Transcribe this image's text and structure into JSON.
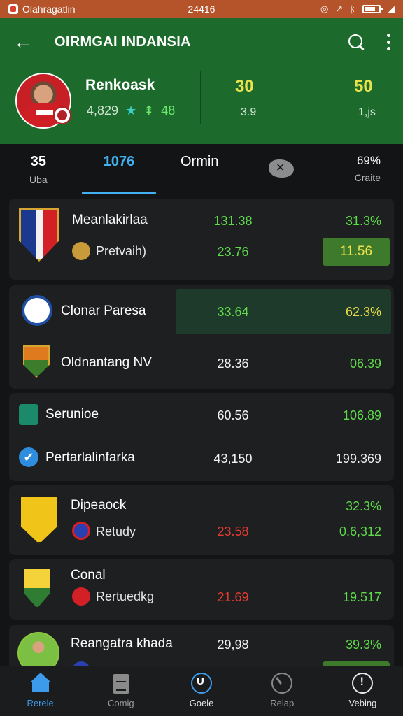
{
  "status_bar": {
    "carrier": "Olahragatlin",
    "time": "24416",
    "battery_level": 0.7
  },
  "header": {
    "title": "OIRMGAI INDANSIA",
    "profile": {
      "name": "Renkoask",
      "followers": "4,829",
      "gain": "48",
      "stat_a_value": "30",
      "stat_a_sub": "3.9",
      "stat_b_value": "50",
      "stat_b_sub": "1,js"
    }
  },
  "tabs": [
    {
      "label": "35",
      "sub": "Uba"
    },
    {
      "label": "1076",
      "sub": ""
    },
    {
      "label": "Ormin",
      "sub": ""
    },
    {
      "label": "",
      "icon": "map-icon"
    },
    {
      "label": "69%",
      "sub": "Craite"
    }
  ],
  "rows": {
    "r1": {
      "name": "Meanlakirlaa",
      "v1": "131.38",
      "v2": "31.3%"
    },
    "r1b": {
      "name": "Pretvaih)",
      "v1": "23.76",
      "pill": "11.56"
    },
    "r2": {
      "name": "Clonar Paresa",
      "v1": "33.64",
      "v2": "62.3%"
    },
    "r3": {
      "name": "Oldnantang NV",
      "v1": "28.36",
      "v2": "06.39"
    },
    "r4": {
      "name": "Serunioe",
      "v1": "60.56",
      "v2": "106.89"
    },
    "r5": {
      "name": "Pertarlalinfarka",
      "v1": "43,150",
      "v2": "199.369"
    },
    "r6": {
      "name": "Dipeaock",
      "v2": "32.3%"
    },
    "r6b": {
      "name": "Retudy",
      "v1": "23.58",
      "v2": "0.6,312"
    },
    "r7": {
      "name": "Conal",
      "v2": ""
    },
    "r7b": {
      "name": "Rertuedkg",
      "v1": "21.69",
      "v2": "19.517"
    },
    "r8": {
      "name": "Reangatra khada",
      "v1": "29,98",
      "v2": "39.3%"
    }
  },
  "bottom_nav": [
    {
      "label": "Rerele",
      "icon": "home-icon"
    },
    {
      "label": "Comig",
      "icon": "clipboard-icon"
    },
    {
      "label": "Goele",
      "icon": "ring-icon"
    },
    {
      "label": "Relap",
      "icon": "gauge-icon"
    },
    {
      "label": "Vebing",
      "icon": "alert-icon"
    }
  ],
  "colors": {
    "header_green": "#1c6b2d",
    "accent_blue": "#43b0ef",
    "value_green": "#5fdc4a",
    "value_yellow": "#e7d94a",
    "value_red": "#e33b2e"
  }
}
